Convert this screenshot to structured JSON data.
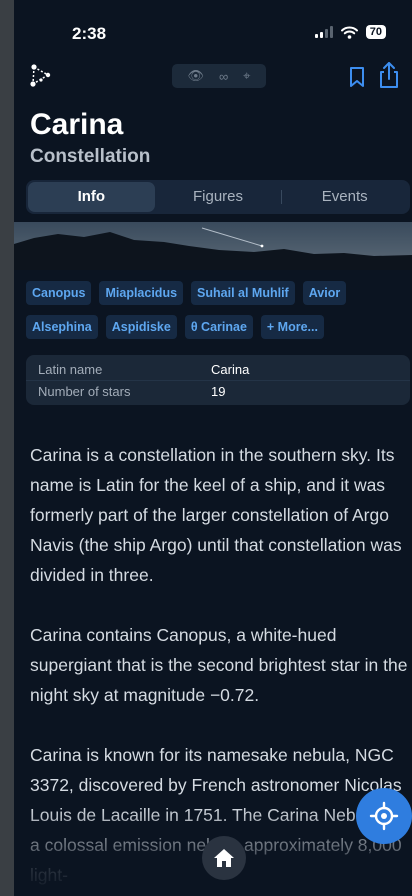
{
  "status_bar": {
    "time": "2:38",
    "battery": "70"
  },
  "header": {
    "title": "Carina",
    "subtitle": "Constellation"
  },
  "tabs": [
    {
      "label": "Info",
      "active": true
    },
    {
      "label": "Figures",
      "active": false
    },
    {
      "label": "Events",
      "active": false
    }
  ],
  "stars": {
    "row1": [
      "Canopus",
      "Miaplacidus",
      "Suhail al Muhlif",
      "Avior"
    ],
    "row2": [
      "Alsephina",
      "Aspidiske",
      "θ Carinae",
      "+ More..."
    ]
  },
  "info_table": [
    {
      "key": "Latin name",
      "value": "Carina"
    },
    {
      "key": "Number of stars",
      "value": "19"
    }
  ],
  "description": [
    "Carina is a constellation in the southern sky. Its name is Latin for the keel of a ship, and it was formerly part of the larger constellation of Argo Navis (the ship Argo) until that constellation was divided in three.",
    "Carina contains Canopus, a white-hued supergiant that is the second brightest star in the night sky at magnitude −0.72.",
    "Carina is known for its namesake nebula, NGC 3372, discovered by French astronomer Nicolas Louis de Lacaille in 1751. The Carina Nebula is a colossal emission nebula approximately 8,000 light-"
  ],
  "colors": {
    "accent": "#2f7ddf",
    "chip_text": "#5ea7f0",
    "background": "#0b1421"
  },
  "icons": {
    "menu": "constellation-logo-icon",
    "bookmark": "bookmark-icon",
    "share": "share-icon",
    "home": "home-icon",
    "locate": "crosshair-icon"
  }
}
